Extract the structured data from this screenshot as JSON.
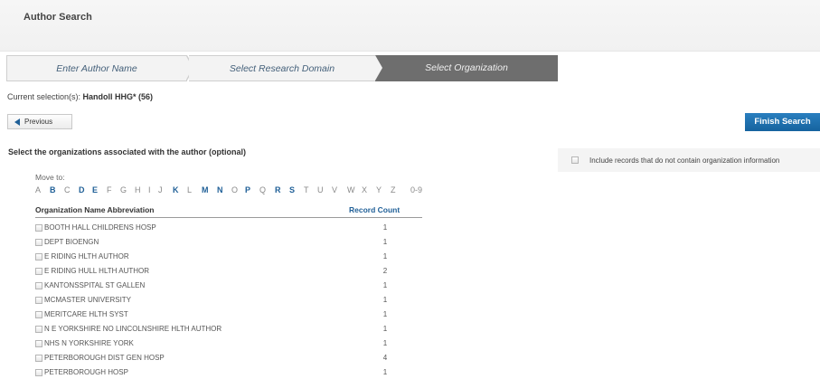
{
  "page": {
    "title": "Author Search"
  },
  "wizard": {
    "steps": [
      {
        "label": "Enter Author Name",
        "state": "completed"
      },
      {
        "label": "Select Research Domain",
        "state": "completed"
      },
      {
        "label": "Select Organization",
        "state": "current"
      }
    ]
  },
  "selection": {
    "prefix": "Current selection(s):",
    "value": "Handoll HHG* (56)"
  },
  "buttons": {
    "previous": "Previous",
    "finish": "Finish Search"
  },
  "instructions": "Select the organizations associated with the author (optional)",
  "include_option": {
    "label": "Include records that do not contain organization information",
    "checked": false
  },
  "move_to": {
    "label": "Move to:",
    "letters": [
      {
        "t": "A",
        "active": false
      },
      {
        "t": "B",
        "active": true
      },
      {
        "t": "C",
        "active": false
      },
      {
        "t": "D",
        "active": true
      },
      {
        "t": "E",
        "active": true
      },
      {
        "t": "F",
        "active": false
      },
      {
        "t": "G",
        "active": false
      },
      {
        "t": "H",
        "active": false
      },
      {
        "t": "I",
        "active": false
      },
      {
        "t": "J",
        "active": false
      },
      {
        "t": "K",
        "active": true
      },
      {
        "t": "L",
        "active": false
      },
      {
        "t": "M",
        "active": true
      },
      {
        "t": "N",
        "active": true
      },
      {
        "t": "O",
        "active": false
      },
      {
        "t": "P",
        "active": true
      },
      {
        "t": "Q",
        "active": false
      },
      {
        "t": "R",
        "active": true
      },
      {
        "t": "S",
        "active": true
      },
      {
        "t": "T",
        "active": false
      },
      {
        "t": "U",
        "active": false
      },
      {
        "t": "V",
        "active": false
      },
      {
        "t": "W",
        "active": false
      },
      {
        "t": "X",
        "active": false
      },
      {
        "t": "Y",
        "active": false
      },
      {
        "t": "Z",
        "active": false
      },
      {
        "t": "0-9",
        "active": false
      }
    ]
  },
  "table": {
    "headers": {
      "org": "Organization Name Abbreviation",
      "count": "Record Count"
    },
    "rows": [
      {
        "org": "BOOTH HALL CHILDRENS HOSP",
        "count": "1"
      },
      {
        "org": "DEPT BIOENGN",
        "count": "1"
      },
      {
        "org": "E RIDING HLTH AUTHOR",
        "count": "1"
      },
      {
        "org": "E RIDING HULL HLTH AUTHOR",
        "count": "2"
      },
      {
        "org": "KANTONSSPITAL ST GALLEN",
        "count": "1"
      },
      {
        "org": "MCMASTER UNIVERSITY",
        "count": "1"
      },
      {
        "org": "MERITCARE HLTH SYST",
        "count": "1"
      },
      {
        "org": "N E YORKSHIRE NO LINCOLNSHIRE HLTH AUTHOR",
        "count": "1"
      },
      {
        "org": "NHS N YORKSHIRE YORK",
        "count": "1"
      },
      {
        "org": "PETERBOROUGH DIST GEN HOSP",
        "count": "4"
      },
      {
        "org": "PETERBOROUGH HOSP",
        "count": "1"
      }
    ]
  },
  "colors": {
    "accent": "#1f5f97",
    "current_step": "#6e6e6e",
    "finish_button": "#1e70b0"
  }
}
